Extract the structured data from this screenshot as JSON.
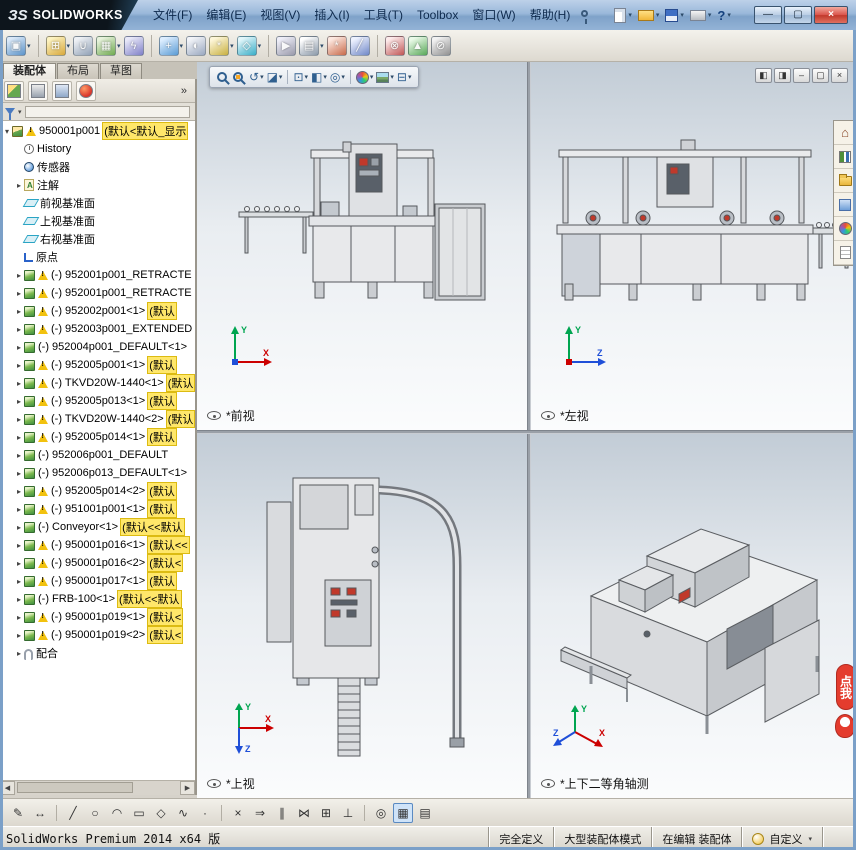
{
  "titlebar": {
    "logo": {
      "prefix": "ЗS",
      "brand": "SOLIDWORKS"
    },
    "menus": [
      {
        "name": "file",
        "label": "文件(F)"
      },
      {
        "name": "edit",
        "label": "编辑(E)"
      },
      {
        "name": "view",
        "label": "视图(V)"
      },
      {
        "name": "insert",
        "label": "插入(I)"
      },
      {
        "name": "tools",
        "label": "工具(T)"
      },
      {
        "name": "toolbox",
        "label": "Toolbox"
      },
      {
        "name": "window",
        "label": "窗口(W)"
      },
      {
        "name": "help",
        "label": "帮助(H)"
      }
    ],
    "quick_icons": [
      {
        "name": "new",
        "kind": "new"
      },
      {
        "name": "open",
        "kind": "open"
      },
      {
        "name": "save",
        "kind": "save"
      },
      {
        "name": "print",
        "kind": "print"
      },
      {
        "name": "help",
        "kind": "help",
        "glyph": "?"
      }
    ],
    "window_controls": {
      "minimize": "—",
      "maximize": "▢",
      "close": "×"
    }
  },
  "assembly_toolbar": {
    "items": [
      {
        "name": "edit-component",
        "glyph": "▣",
        "c1": "#dbe9f8",
        "c2": "#5b93c9",
        "caret": true
      },
      {
        "sep": true
      },
      {
        "name": "insert-components",
        "glyph": "⊞",
        "c1": "#fdf3c0",
        "c2": "#d8a83a",
        "caret": true
      },
      {
        "name": "mate",
        "glyph": "∪",
        "c1": "#eef1f5",
        "c2": "#90a0b5"
      },
      {
        "name": "linear-component-pattern",
        "glyph": "▦",
        "c1": "#e7f2dc",
        "c2": "#6faa4f",
        "caret": true
      },
      {
        "name": "smart-fasteners",
        "glyph": "ϟ",
        "c1": "#e8e8f8",
        "c2": "#8080c8"
      },
      {
        "sep": true
      },
      {
        "name": "move-component",
        "glyph": "+",
        "c1": "#ddeeff",
        "c2": "#5a9bd4",
        "caret": true
      },
      {
        "name": "show-hidden-components",
        "glyph": "◐",
        "c1": "#f2f4f8",
        "c2": "#9aa8c0"
      },
      {
        "name": "assembly-features",
        "glyph": "*",
        "c1": "#fdf6d8",
        "c2": "#c8b040",
        "caret": true
      },
      {
        "name": "reference-geometry",
        "glyph": "◇",
        "c1": "#e2f6fa",
        "c2": "#38aec8",
        "caret": true
      },
      {
        "sep": true
      },
      {
        "name": "new-motion-study",
        "glyph": "▶",
        "c1": "#eeeef8",
        "c2": "#9999aa"
      },
      {
        "name": "bill-of-materials",
        "glyph": "▤",
        "c1": "#ffffff",
        "c2": "#8a98a8",
        "caret": true
      },
      {
        "name": "exploded-view",
        "glyph": "*",
        "c1": "#fde8e0",
        "c2": "#c86a4a"
      },
      {
        "name": "explode-line-sketch",
        "glyph": "╱",
        "c1": "#eef2ff",
        "c2": "#7088c8"
      },
      {
        "sep": true
      },
      {
        "name": "interference-detection",
        "glyph": "⊗",
        "c1": "#fdeaea",
        "c2": "#c05555"
      },
      {
        "name": "instant3d",
        "glyph": "▲",
        "c1": "#eafae8",
        "c2": "#58a858"
      },
      {
        "name": "large-assembly-mode",
        "glyph": "⊘",
        "c1": "#f2f2f2",
        "c2": "#909090"
      }
    ]
  },
  "command_tabs": [
    {
      "name": "assembly",
      "label": "装配体",
      "active": true
    },
    {
      "name": "layout",
      "label": "布局",
      "active": false
    },
    {
      "name": "sketch",
      "label": "草图",
      "active": false
    }
  ],
  "panel_tabs": {
    "icons": [
      {
        "name": "feature-manager",
        "kind": "pt-feat"
      },
      {
        "name": "property-manager",
        "kind": "pt-prop"
      },
      {
        "name": "configuration-manager",
        "kind": "pt-conf"
      },
      {
        "name": "display-manager",
        "kind": "pt-disp"
      }
    ],
    "overflow": "»"
  },
  "tree": {
    "items": [
      {
        "root": true,
        "icon": "assembly",
        "expand": "open",
        "warning": true,
        "label": "950001p001",
        "suffix": "(默认<默认_显示"
      },
      {
        "icon": "history",
        "label": "History"
      },
      {
        "icon": "sensor",
        "label": "传感器"
      },
      {
        "icon": "annotation",
        "expand": "closed",
        "label": "注解"
      },
      {
        "icon": "plane",
        "label": "前视基准面"
      },
      {
        "icon": "plane",
        "label": "上视基准面"
      },
      {
        "icon": "plane",
        "label": "右视基准面"
      },
      {
        "icon": "origin",
        "label": "原点"
      },
      {
        "icon": "component",
        "expand": "closed",
        "warning": true,
        "label": "(-) 952001p001_RETRACTE",
        "suffix": ""
      },
      {
        "icon": "component",
        "expand": "closed",
        "warning": true,
        "label": "(-) 952001p001_RETRACTE",
        "suffix": ""
      },
      {
        "icon": "component",
        "expand": "closed",
        "warning": true,
        "label": "(-) 952002p001<1>",
        "suffix": "(默认"
      },
      {
        "icon": "component",
        "expand": "closed",
        "warning": true,
        "label": "(-) 952003p001_EXTENDED",
        "suffix": ""
      },
      {
        "icon": "component",
        "expand": "closed",
        "warning": false,
        "label": "(-) 952004p001_DEFAULT<1>",
        "suffix": ""
      },
      {
        "icon": "component",
        "expand": "closed",
        "warning": true,
        "label": "(-) 952005p001<1>",
        "suffix": "(默认"
      },
      {
        "icon": "component",
        "expand": "closed",
        "warning": true,
        "label": "(-) TKVD20W-1440<1>",
        "suffix": "(默认"
      },
      {
        "icon": "component",
        "expand": "closed",
        "warning": true,
        "label": "(-) 952005p013<1>",
        "suffix": "(默认"
      },
      {
        "icon": "component",
        "expand": "closed",
        "warning": true,
        "label": "(-) TKVD20W-1440<2>",
        "suffix": "(默认"
      },
      {
        "icon": "component",
        "expand": "closed",
        "warning": true,
        "label": "(-) 952005p014<1>",
        "suffix": "(默认"
      },
      {
        "icon": "component",
        "expand": "closed",
        "warning": false,
        "label": "(-) 952006p001_DEFAULT",
        "suffix": ""
      },
      {
        "icon": "component",
        "expand": "closed",
        "warning": false,
        "label": "(-) 952006p013_DEFAULT<1>",
        "suffix": ""
      },
      {
        "icon": "component",
        "expand": "closed",
        "warning": true,
        "label": "(-) 952005p014<2>",
        "suffix": "(默认"
      },
      {
        "icon": "component",
        "expand": "closed",
        "warning": true,
        "label": "(-) 951001p001<1>",
        "suffix": "(默认"
      },
      {
        "icon": "component",
        "expand": "closed",
        "warning": false,
        "label": "(-) Conveyor<1>",
        "suffix": "(默认<<默认"
      },
      {
        "icon": "component",
        "expand": "closed",
        "warning": true,
        "label": "(-) 950001p016<1>",
        "suffix": "(默认<<"
      },
      {
        "icon": "component",
        "expand": "closed",
        "warning": true,
        "label": "(-) 950001p016<2>",
        "suffix": "(默认<"
      },
      {
        "icon": "component",
        "expand": "closed",
        "warning": true,
        "label": "(-) 950001p017<1>",
        "suffix": "(默认"
      },
      {
        "icon": "component",
        "expand": "closed",
        "warning": false,
        "label": "(-) FRB-100<1>",
        "suffix": "(默认<<默认"
      },
      {
        "icon": "component",
        "expand": "closed",
        "warning": true,
        "label": "(-) 950001p019<1>",
        "suffix": "(默认<"
      },
      {
        "icon": "component",
        "expand": "closed",
        "warning": true,
        "label": "(-) 950001p019<2>",
        "suffix": "(默认<"
      },
      {
        "icon": "mates",
        "expand": "closed",
        "label": "配合"
      }
    ]
  },
  "viewport": {
    "headsup": [
      {
        "name": "zoom-to-fit",
        "kind": "mag"
      },
      {
        "name": "zoom-to-area",
        "kind": "mag2"
      },
      {
        "name": "previous-view",
        "glyph": "↺",
        "caret": true
      },
      {
        "name": "section-view",
        "glyph": "◪",
        "caret": true
      },
      {
        "sep": true
      },
      {
        "name": "view-orientation",
        "glyph": "⊡",
        "caret": true
      },
      {
        "name": "display-style",
        "glyph": "◧",
        "caret": true
      },
      {
        "name": "hide-show-items",
        "glyph": "◎",
        "caret": true
      },
      {
        "sep": true
      },
      {
        "name": "edit-appearance",
        "kind": "ball",
        "caret": true
      },
      {
        "name": "apply-scene",
        "kind": "scene",
        "caret": true
      },
      {
        "name": "view-settings",
        "glyph": "⊟",
        "caret": true
      }
    ],
    "doc_controls": [
      {
        "name": "tile-left",
        "glyph": "◧"
      },
      {
        "name": "tile-right",
        "glyph": "◨"
      },
      {
        "name": "minimize-document",
        "glyph": "–"
      },
      {
        "name": "restore-document",
        "glyph": "▢"
      },
      {
        "name": "close-document",
        "glyph": "×"
      }
    ],
    "views": [
      {
        "name": "front",
        "label": "*前视"
      },
      {
        "name": "left",
        "label": "*左视"
      },
      {
        "name": "top",
        "label": "*上视"
      },
      {
        "name": "isometric",
        "label": "*上下二等角轴测"
      }
    ]
  },
  "axes": {
    "x": "X",
    "y": "Y",
    "z": "Z"
  },
  "task_pane": {
    "icons": [
      {
        "name": "solidworks-resources",
        "kind": "tp-home",
        "glyph": "⌂"
      },
      {
        "name": "design-library",
        "kind": "tp-books"
      },
      {
        "name": "file-explorer",
        "kind": "tp-folder"
      },
      {
        "name": "view-palette",
        "kind": "tp-palette"
      },
      {
        "name": "appearances-scenes",
        "kind": "tp-ball"
      },
      {
        "name": "custom-properties",
        "kind": "tp-note"
      }
    ]
  },
  "float_badge": {
    "label": "点我"
  },
  "sketch_toolbar": {
    "items": [
      {
        "name": "sketch",
        "glyph": "✎"
      },
      {
        "name": "smart-dimension",
        "glyph": "↔"
      },
      {
        "sep": true
      },
      {
        "name": "line",
        "glyph": "╱"
      },
      {
        "name": "circle",
        "glyph": "○"
      },
      {
        "name": "arc",
        "glyph": "◠"
      },
      {
        "name": "rectangle",
        "glyph": "▭"
      },
      {
        "name": "polygon",
        "glyph": "◇"
      },
      {
        "name": "spline",
        "glyph": "∿"
      },
      {
        "name": "point",
        "glyph": "·"
      },
      {
        "sep": true
      },
      {
        "name": "trim-entities",
        "glyph": "×"
      },
      {
        "name": "convert-entities",
        "glyph": "⇒"
      },
      {
        "name": "offset-entities",
        "glyph": "∥"
      },
      {
        "name": "mirror-entities",
        "glyph": "⋈"
      },
      {
        "name": "linear-sketch-pattern",
        "glyph": "⊞"
      },
      {
        "name": "display-relations",
        "glyph": "⊥"
      },
      {
        "sep": true
      },
      {
        "name": "quick-snaps",
        "glyph": "◎"
      },
      {
        "name": "grid-system",
        "glyph": "▦",
        "active": true
      },
      {
        "name": "instant2d",
        "glyph": "▤"
      }
    ]
  },
  "statusbar": {
    "product": "SolidWorks Premium 2014 x64 版",
    "defined": "完全定义",
    "large_assembly": "大型装配体模式",
    "editing": "在编辑 装配体",
    "custom": "自定义"
  }
}
